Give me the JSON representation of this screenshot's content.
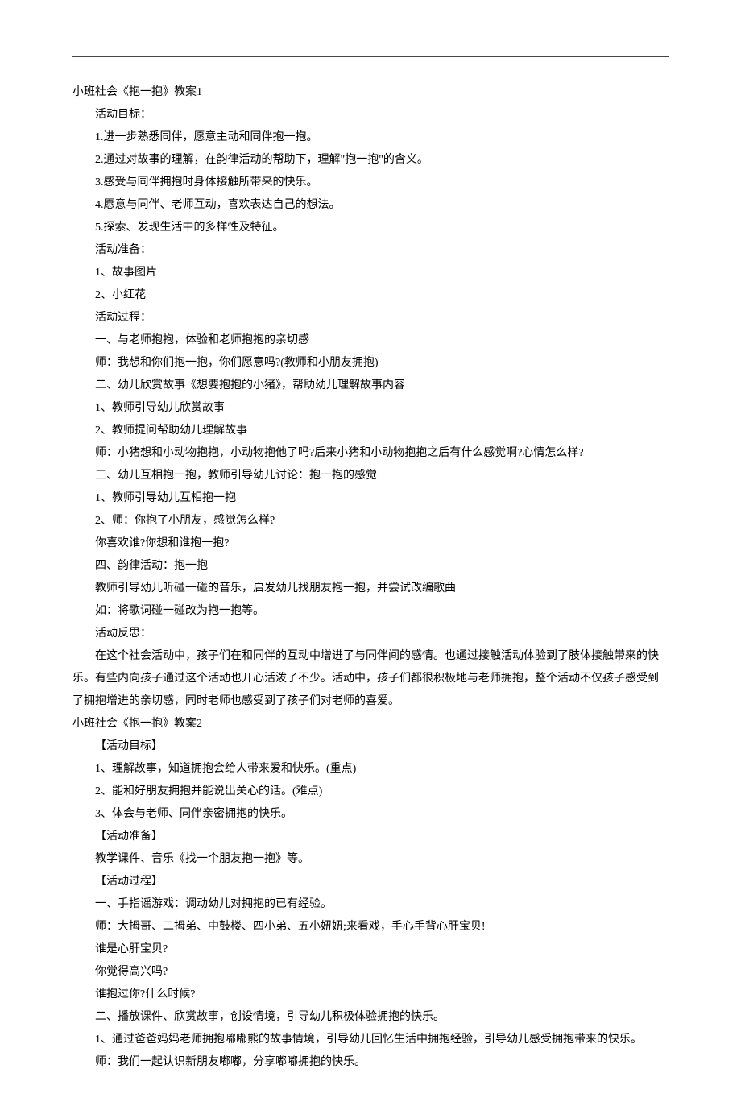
{
  "lines": [
    {
      "indent": 0,
      "text": "小班社会《抱一抱》教案1"
    },
    {
      "indent": 1,
      "text": "活动目标："
    },
    {
      "indent": 1,
      "text": "1.进一步熟悉同伴，愿意主动和同伴抱一抱。"
    },
    {
      "indent": 1,
      "text": "2.通过对故事的理解，在韵律活动的帮助下，理解\"抱一抱\"的含义。"
    },
    {
      "indent": 1,
      "text": "3.感受与同伴拥抱时身体接触所带来的快乐。"
    },
    {
      "indent": 1,
      "text": "4.愿意与同伴、老师互动，喜欢表达自己的想法。"
    },
    {
      "indent": 1,
      "text": "5.探索、发现生活中的多样性及特征。"
    },
    {
      "indent": 1,
      "text": "活动准备："
    },
    {
      "indent": 1,
      "text": "1、故事图片"
    },
    {
      "indent": 1,
      "text": "2、小红花"
    },
    {
      "indent": 1,
      "text": "活动过程："
    },
    {
      "indent": 1,
      "text": "一、与老师抱抱，体验和老师抱抱的亲切感"
    },
    {
      "indent": 1,
      "text": "师：我想和你们抱一抱，你们愿意吗?(教师和小朋友拥抱)"
    },
    {
      "indent": 1,
      "text": "二、幼儿欣赏故事《想要抱抱的小猪》，帮助幼儿理解故事内容"
    },
    {
      "indent": 1,
      "text": "1、教师引导幼儿欣赏故事"
    },
    {
      "indent": 1,
      "text": "2、教师提问帮助幼儿理解故事"
    },
    {
      "indent": 1,
      "text": "师：小猪想和小动物抱抱，小动物抱他了吗?后来小猪和小动物抱抱之后有什么感觉啊?心情怎么样?"
    },
    {
      "indent": 1,
      "text": "三、幼儿互相抱一抱，教师引导幼儿讨论：抱一抱的感觉"
    },
    {
      "indent": 1,
      "text": "1、教师引导幼儿互相抱一抱"
    },
    {
      "indent": 1,
      "text": "2、师：你抱了小朋友，感觉怎么样?"
    },
    {
      "indent": 1,
      "text": "你喜欢谁?你想和谁抱一抱?"
    },
    {
      "indent": 1,
      "text": "四、韵律活动：抱一抱"
    },
    {
      "indent": 1,
      "text": "教师引导幼儿听碰一碰的音乐，启发幼儿找朋友抱一抱，并尝试改编歌曲"
    },
    {
      "indent": 1,
      "text": "如：将歌词碰一碰改为抱一抱等。"
    },
    {
      "indent": 1,
      "text": "活动反思："
    },
    {
      "indent": 1,
      "text": "在这个社会活动中，孩子们在和同伴的互动中增进了与同伴间的感情。也通过接触活动体验到了肢体接触带来的快乐。有些内向孩子通过这个活动也开心活泼了不少。活动中，孩子们都很积极地与老师拥抱，整个活动不仅孩子感受到了拥抱增进的亲切感，同时老师也感受到了孩子们对老师的喜爱。"
    },
    {
      "indent": 0,
      "text": "小班社会《抱一抱》教案2"
    },
    {
      "indent": 1,
      "text": "【活动目标】"
    },
    {
      "indent": 1,
      "text": "1、理解故事，知道拥抱会给人带来爱和快乐。(重点)"
    },
    {
      "indent": 1,
      "text": "2、能和好朋友拥抱并能说出关心的话。(难点)"
    },
    {
      "indent": 1,
      "text": "3、体会与老师、同伴亲密拥抱的快乐。"
    },
    {
      "indent": 1,
      "text": "【活动准备】"
    },
    {
      "indent": 1,
      "text": "教学课件、音乐《找一个朋友抱一抱》等。"
    },
    {
      "indent": 1,
      "text": "【活动过程】"
    },
    {
      "indent": 1,
      "text": "一、手指谣游戏：调动幼儿对拥抱的已有经验。"
    },
    {
      "indent": 1,
      "text": "师：大拇哥、二拇弟、中鼓楼、四小弟、五小妞妞;来看戏，手心手背心肝宝贝!"
    },
    {
      "indent": 1,
      "text": "谁是心肝宝贝?"
    },
    {
      "indent": 1,
      "text": "你觉得高兴吗?"
    },
    {
      "indent": 1,
      "text": "谁抱过你?什么时候?"
    },
    {
      "indent": 1,
      "text": "二、播放课件、欣赏故事，创设情境，引导幼儿积极体验拥抱的快乐。"
    },
    {
      "indent": 1,
      "text": "1、通过爸爸妈妈老师拥抱嘟嘟熊的故事情境，引导幼儿回忆生活中拥抱经验，引导幼儿感受拥抱带来的快乐。"
    },
    {
      "indent": 1,
      "text": "师：我们一起认识新朋友嘟嘟，分享嘟嘟拥抱的快乐。"
    }
  ]
}
